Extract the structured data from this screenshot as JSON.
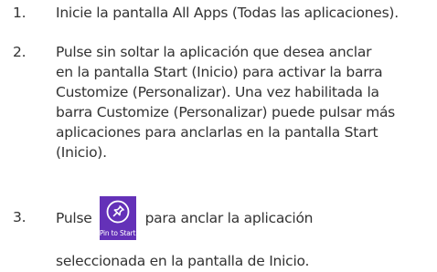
{
  "steps": [
    {
      "number": "1.",
      "text": "Inicie la pantalla All Apps (Todas las aplicaciones)."
    },
    {
      "number": "2.",
      "text": "Pulse sin soltar la aplicación que desea anclar\nen la pantalla Start (Inicio) para activar la barra\nCustomize (Personalizar). Una vez habilitada la\nbarra Customize (Personalizar) puede pulsar más\naplicaciones para anclarlas en la pantalla Start\n(Inicio)."
    },
    {
      "number": "3.",
      "before_icon": "Pulse",
      "after_icon": "para anclar la aplicación",
      "continuation": "seleccionada en la pantalla de Inicio.",
      "button": {
        "label": "Pin to Start",
        "icon": "pin-icon",
        "color": "#6431b8"
      }
    }
  ]
}
